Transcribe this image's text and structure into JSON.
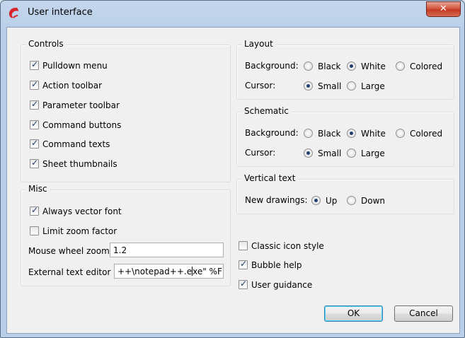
{
  "window": {
    "title": "User interface",
    "close_glyph": "✕",
    "logo_icon": "app-logo-icon"
  },
  "controls": {
    "title": "Controls",
    "items": [
      {
        "label": "Pulldown menu",
        "checked": true
      },
      {
        "label": "Action toolbar",
        "checked": true
      },
      {
        "label": "Parameter toolbar",
        "checked": true
      },
      {
        "label": "Command buttons",
        "checked": true
      },
      {
        "label": "Command texts",
        "checked": true
      },
      {
        "label": "Sheet thumbnails",
        "checked": true
      }
    ]
  },
  "misc": {
    "title": "Misc",
    "always_vector_font": {
      "label": "Always vector font",
      "checked": true
    },
    "limit_zoom_factor": {
      "label": "Limit zoom factor",
      "checked": false
    },
    "mouse_wheel_zoom": {
      "label": "Mouse wheel zoom",
      "value": "1.2"
    },
    "external_text_editor": {
      "label": "External text editor",
      "value_before": "++\\notepad++.e",
      "value_after": "xe\" %F"
    }
  },
  "layout": {
    "title": "Layout",
    "background_label": "Background:",
    "cursor_label": "Cursor:",
    "background_options": [
      "Black",
      "White",
      "Colored"
    ],
    "background_selected": "White",
    "cursor_options": [
      "Small",
      "Large"
    ],
    "cursor_selected": "Small"
  },
  "schematic": {
    "title": "Schematic",
    "background_label": "Background:",
    "cursor_label": "Cursor:",
    "background_options": [
      "Black",
      "White",
      "Colored"
    ],
    "background_selected": "White",
    "cursor_options": [
      "Small",
      "Large"
    ],
    "cursor_selected": "Small"
  },
  "vertical_text": {
    "title": "Vertical text",
    "new_drawings_label": "New drawings:",
    "options": [
      "Up",
      "Down"
    ],
    "selected": "Up"
  },
  "extras": [
    {
      "label": "Classic icon style",
      "checked": false
    },
    {
      "label": "Bubble help",
      "checked": true
    },
    {
      "label": "User guidance",
      "checked": true
    }
  ],
  "buttons": {
    "ok": "OK",
    "cancel": "Cancel"
  },
  "colors": {
    "close_button": "#c23a24",
    "check_mark": "#233d6e",
    "default_button_border": "#3c7fb1"
  }
}
